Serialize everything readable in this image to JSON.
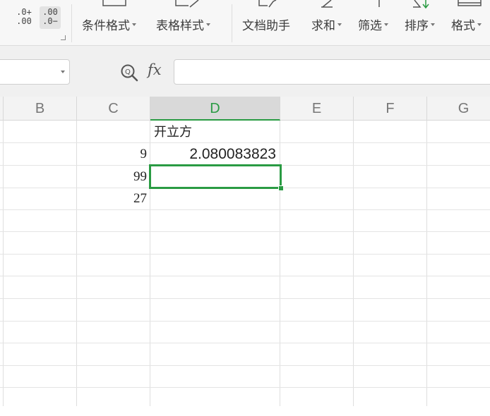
{
  "ribbon": {
    "decimal_increase": {
      "top": ".0+",
      "bottom": ".00",
      "icon": "increase-decimal-icon"
    },
    "decimal_decrease": {
      "top": ".00",
      "bottom": ".0−",
      "icon": "decrease-decimal-icon"
    },
    "conditional_format": "条件格式",
    "table_style": "表格样式",
    "doc_assistant": "文档助手",
    "sum": "求和",
    "filter": "筛选",
    "sort": "排序",
    "format": "格式"
  },
  "formula_bar": {
    "name_box_value": "",
    "fx_label": "fx",
    "formula_value": ""
  },
  "columns": [
    "B",
    "C",
    "D",
    "E",
    "F",
    "G"
  ],
  "selected_column": "D",
  "cells": {
    "D1": "开立方",
    "C2": "9",
    "D2": "2.080083823",
    "C3": "99",
    "C4": "27"
  },
  "colors": {
    "accent_green": "#2a9b43",
    "header_bg": "#f3f3f3"
  }
}
